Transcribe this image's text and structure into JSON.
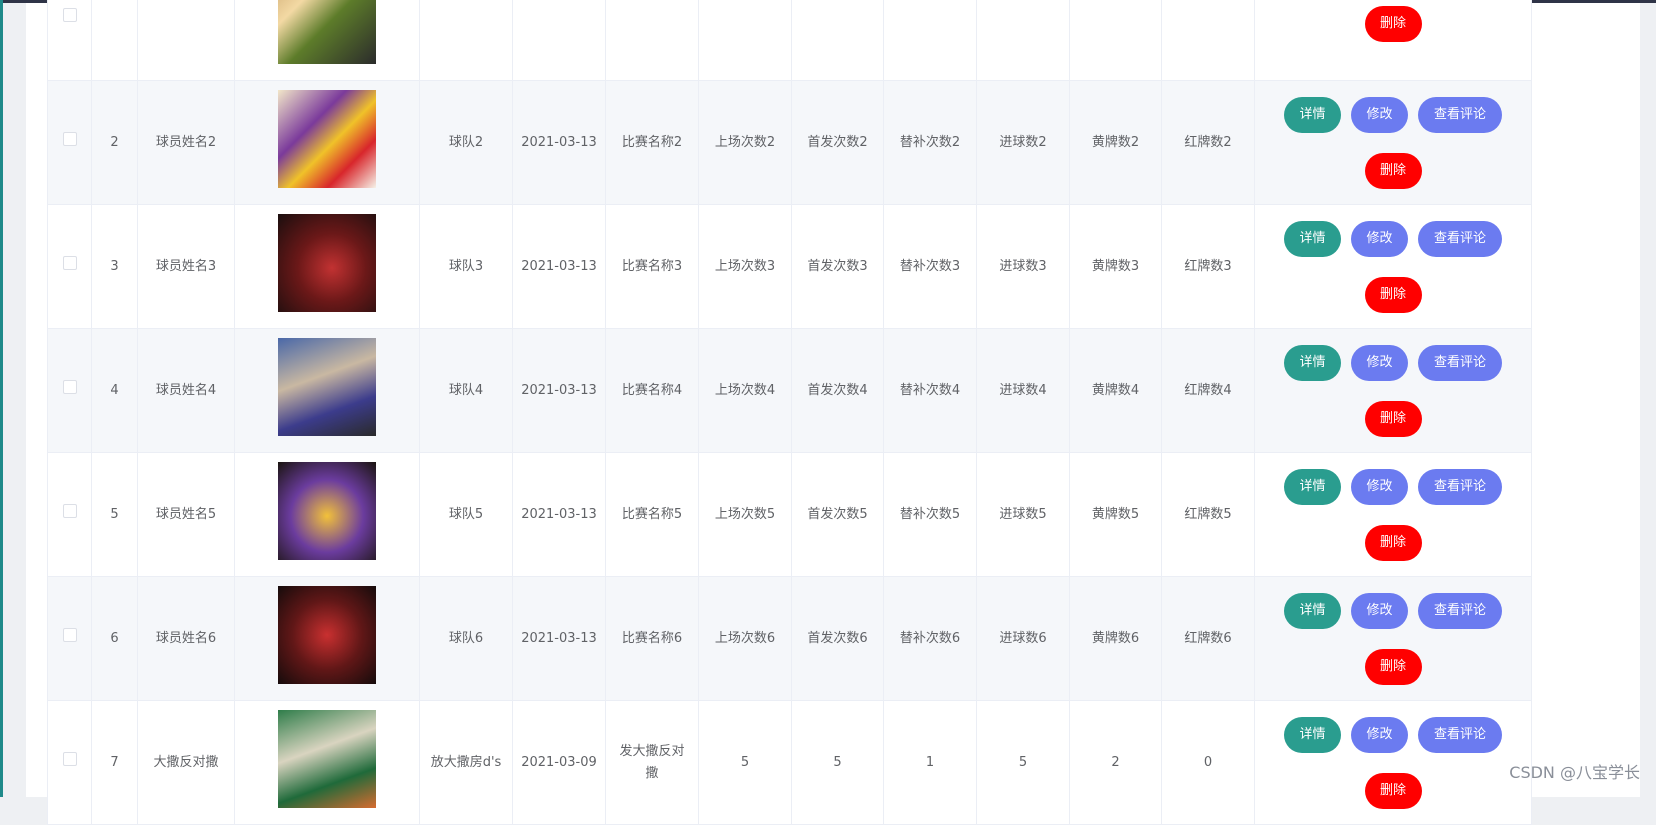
{
  "table": {
    "actions": {
      "detail": "详情",
      "edit": "修改",
      "view_comments": "查看评论",
      "delete": "删除"
    },
    "rows": [
      {
        "index": "",
        "player_name": "",
        "team": "",
        "date": "",
        "match": "",
        "appearances": "",
        "starts": "",
        "subs": "",
        "goals": "",
        "yellow": "",
        "red": ""
      },
      {
        "index": "2",
        "player_name": "球员姓名2",
        "team": "球队2",
        "date": "2021-03-13",
        "match": "比赛名称2",
        "appearances": "上场次数2",
        "starts": "首发次数2",
        "subs": "替补次数2",
        "goals": "进球数2",
        "yellow": "黄牌数2",
        "red": "红牌数2"
      },
      {
        "index": "3",
        "player_name": "球员姓名3",
        "team": "球队3",
        "date": "2021-03-13",
        "match": "比赛名称3",
        "appearances": "上场次数3",
        "starts": "首发次数3",
        "subs": "替补次数3",
        "goals": "进球数3",
        "yellow": "黄牌数3",
        "red": "红牌数3"
      },
      {
        "index": "4",
        "player_name": "球员姓名4",
        "team": "球队4",
        "date": "2021-03-13",
        "match": "比赛名称4",
        "appearances": "上场次数4",
        "starts": "首发次数4",
        "subs": "替补次数4",
        "goals": "进球数4",
        "yellow": "黄牌数4",
        "red": "红牌数4"
      },
      {
        "index": "5",
        "player_name": "球员姓名5",
        "team": "球队5",
        "date": "2021-03-13",
        "match": "比赛名称5",
        "appearances": "上场次数5",
        "starts": "首发次数5",
        "subs": "替补次数5",
        "goals": "进球数5",
        "yellow": "黄牌数5",
        "red": "红牌数5"
      },
      {
        "index": "6",
        "player_name": "球员姓名6",
        "team": "球队6",
        "date": "2021-03-13",
        "match": "比赛名称6",
        "appearances": "上场次数6",
        "starts": "首发次数6",
        "subs": "替补次数6",
        "goals": "进球数6",
        "yellow": "黄牌数6",
        "red": "红牌数6"
      },
      {
        "index": "7",
        "player_name": "大撒反对撒",
        "team": "放大撒房d's",
        "date": "2021-03-09",
        "match": "发大撒反对撒",
        "appearances": "5",
        "starts": "5",
        "subs": "1",
        "goals": "5",
        "yellow": "2",
        "red": "0"
      }
    ]
  },
  "watermark": "CSDN @八宝学长",
  "colors": {
    "detail_button": "#2a9d8f",
    "edit_button": "#6b7bf0",
    "delete_button": "#ff0000",
    "stripe_row": "#f5f7fa"
  }
}
